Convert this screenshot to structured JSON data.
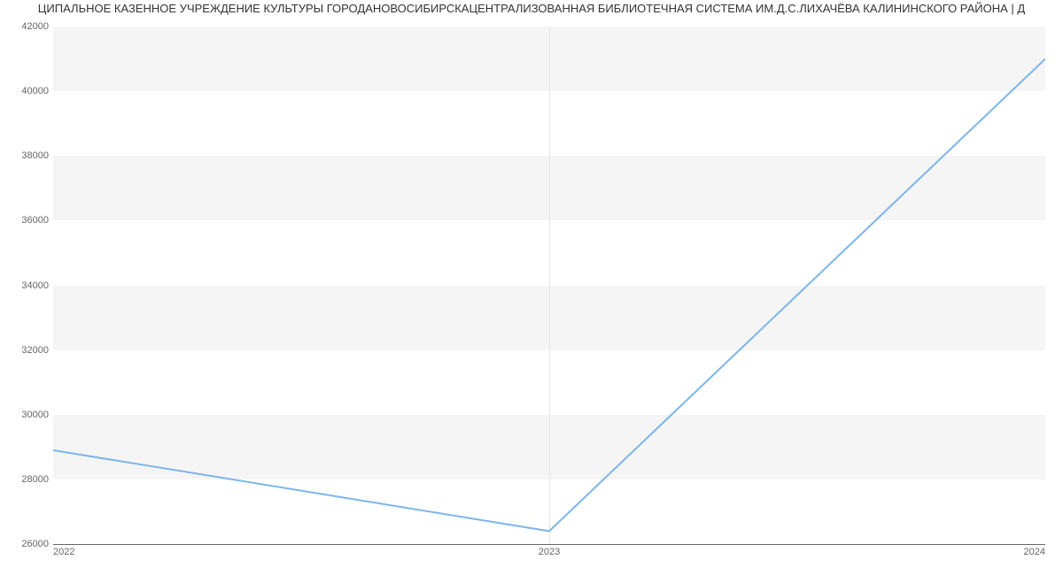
{
  "chart_data": {
    "type": "line",
    "title": "ЦИПАЛЬНОЕ КАЗЕННОЕ УЧРЕЖДЕНИЕ КУЛЬТУРЫ ГОРОДАНОВОСИБИРСКАЦЕНТРАЛИЗОВАННАЯ БИБЛИОТЕЧНАЯ СИСТЕМА ИМ.Д.С.ЛИХАЧЁВА КАЛИНИНСКОГО РАЙОНА | Д",
    "x": [
      2022,
      2023,
      2024
    ],
    "values": [
      28900,
      26400,
      41000
    ],
    "xticks": [
      "2022",
      "2023",
      "2024"
    ],
    "yticks": [
      26000,
      28000,
      30000,
      32000,
      34000,
      36000,
      38000,
      40000,
      42000
    ],
    "ylim": [
      26000,
      42000
    ],
    "xlabel": "",
    "ylabel": ""
  }
}
